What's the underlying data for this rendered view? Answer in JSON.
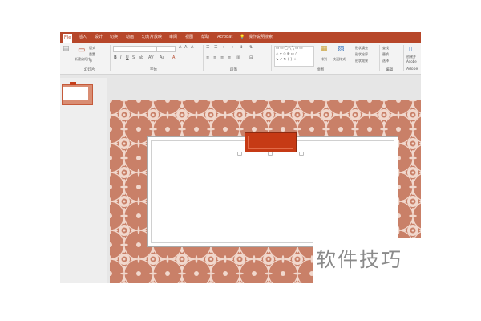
{
  "tabs": [
    "File",
    "插入",
    "设计",
    "切换",
    "动画",
    "幻灯片放映",
    "审阅",
    "视图",
    "帮助",
    "Acrobat",
    "操作说明搜索"
  ],
  "ribbon": {
    "slides_group": {
      "label": "幻灯片",
      "new_slide": "新建幻灯片",
      "layout": "版式",
      "reset": "重置",
      "section": "节"
    },
    "font_group": {
      "label": "字体"
    },
    "paragraph_group": {
      "label": "段落"
    },
    "drawing_group": {
      "label": "绘图",
      "arrange": "排列",
      "quick_styles": "快速样式",
      "shape_fill": "形状填充",
      "shape_outline": "形状轮廓",
      "shape_effects": "形状效果"
    },
    "editing_group": {
      "label": "编辑",
      "find": "查找",
      "replace": "替换",
      "select": "选择"
    },
    "adobe_group": {
      "label": "Adobe",
      "create_pdf": "创建并",
      "adobe_text": "Adobe"
    }
  },
  "watermark": "软件技巧",
  "colors": {
    "accent": "#b7472a",
    "slide_pattern": "#c98068",
    "title_bar": "#c63a15"
  }
}
